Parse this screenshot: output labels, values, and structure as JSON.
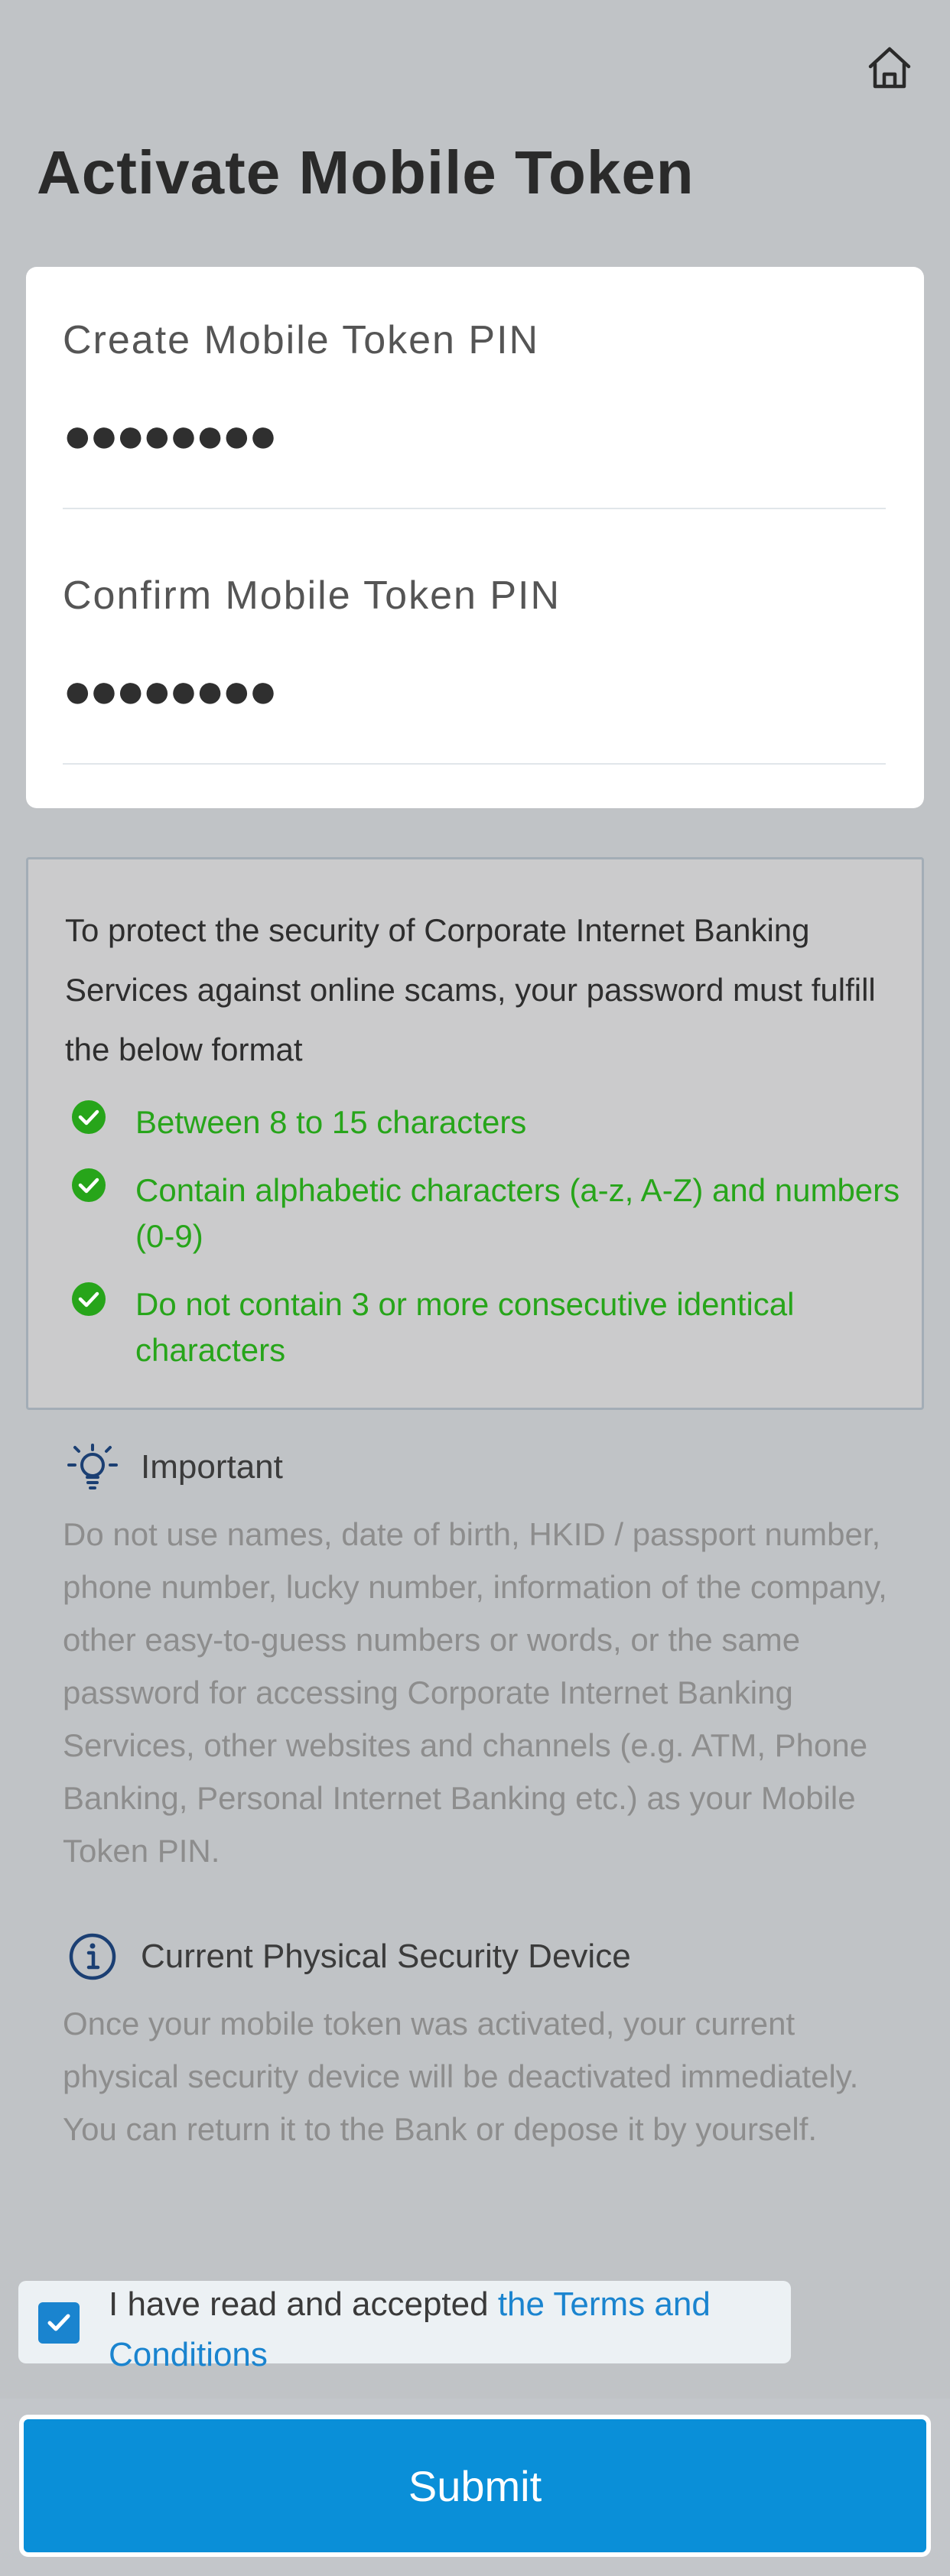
{
  "header": {
    "home_icon": "home-icon",
    "title": "Activate Mobile Token"
  },
  "pin_form": {
    "create_label": "Create Mobile Token PIN",
    "create_value": "●●●●●●●●",
    "confirm_label": "Confirm Mobile Token PIN",
    "confirm_value": "●●●●●●●●"
  },
  "password_rules": {
    "intro": "To protect the security of Corporate Internet Banking Services against online scams, your password must fulfill the below format",
    "rules": [
      {
        "text": "Between 8 to 15 characters",
        "status": "passed"
      },
      {
        "text": "Contain alphabetic characters (a-z, A-Z) and numbers (0-9)",
        "status": "passed"
      },
      {
        "text": "Do not contain 3 or more consecutive identical characters",
        "status": "passed"
      }
    ],
    "pass_color": "#27a51a"
  },
  "important": {
    "icon": "lightbulb-icon",
    "title": "Important",
    "body": "Do not use names, date of birth, HKID / passport number, phone number, lucky number, information of the company, other easy-to-guess numbers or words, or the same password for accessing Corporate Internet Banking Services, other websites and channels (e.g. ATM, Phone Banking, Personal Internet Banking etc.) as your Mobile Token PIN."
  },
  "security_device": {
    "icon": "info-icon",
    "title": "Current Physical Security Device",
    "body": "Once your mobile token was activated, your current physical security device will be deactivated immediately. You can return it to the Bank or depose it by yourself."
  },
  "terms": {
    "checked": true,
    "text_prefix": "I have read and accepted ",
    "link_text": "the Terms and Conditions"
  },
  "submit": {
    "label": "Submit"
  },
  "colors": {
    "accent": "#0a8fd8",
    "background": "#c0c3c6"
  }
}
